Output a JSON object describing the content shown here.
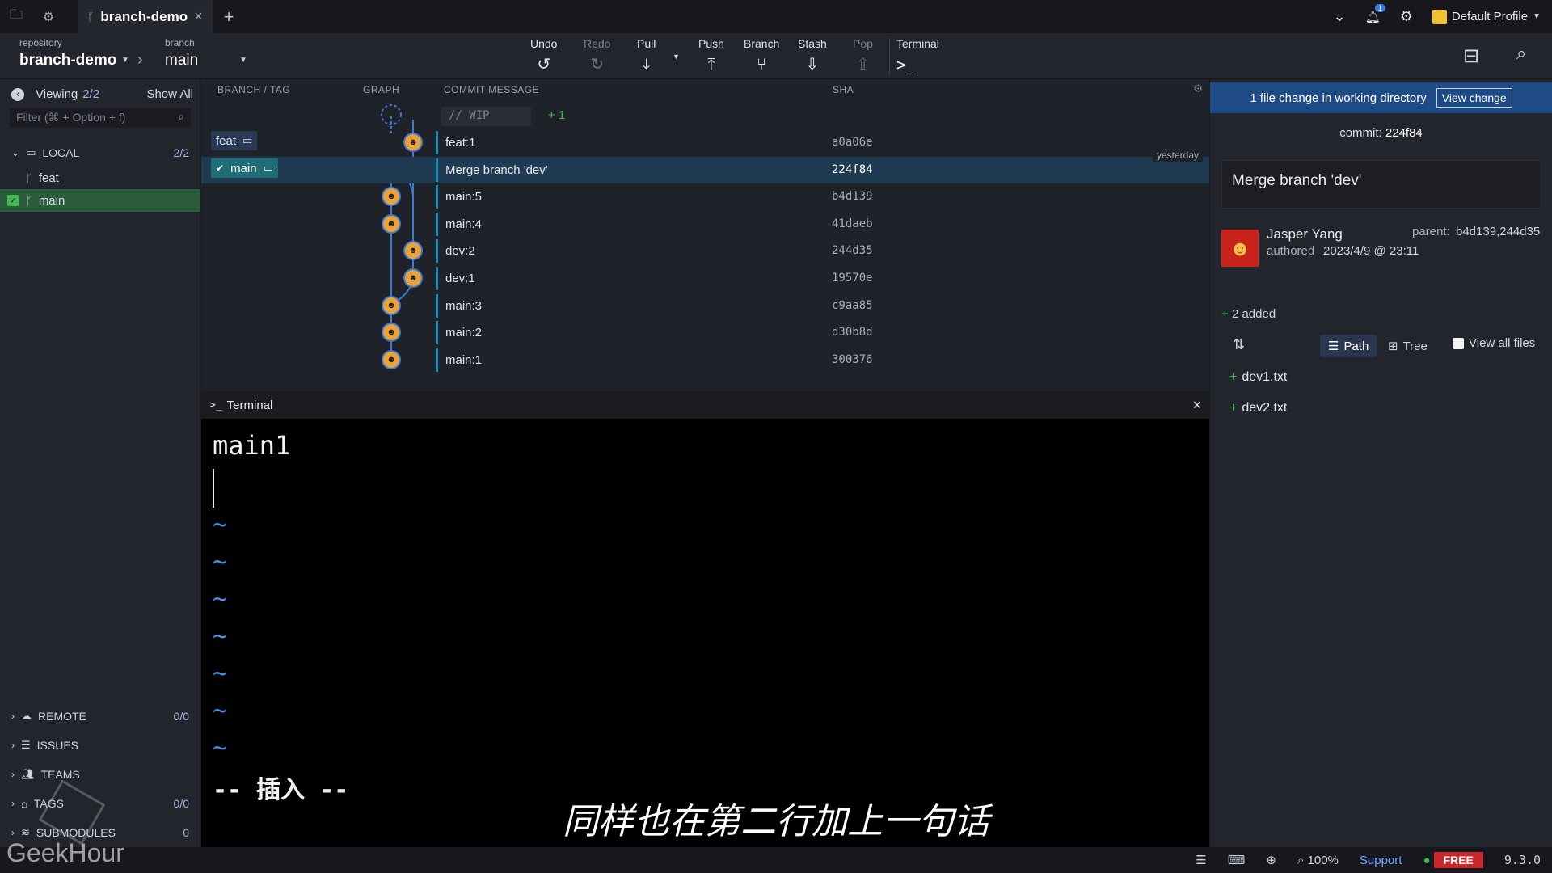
{
  "titlebar": {
    "tab_title": "branch-demo",
    "tab_close": "×",
    "new_tab": "+",
    "notifications_count": "1",
    "profile_label": "Default Profile"
  },
  "toolbar": {
    "repository_label": "repository",
    "repository_value": "branch-demo",
    "branch_label": "branch",
    "branch_value": "main",
    "undo": "Undo",
    "redo": "Redo",
    "pull": "Pull",
    "push": "Push",
    "branch": "Branch",
    "stash": "Stash",
    "pop": "Pop",
    "terminal": "Terminal"
  },
  "left_panel": {
    "viewing_label": "Viewing",
    "viewing_count": "2/2",
    "show_all": "Show All",
    "filter_placeholder": "Filter (⌘ + Option + f)",
    "local": {
      "label": "LOCAL",
      "count": "2/2",
      "branches": [
        "feat",
        "main"
      ]
    },
    "remote": {
      "label": "REMOTE",
      "count": "0/0"
    },
    "issues": {
      "label": "ISSUES"
    },
    "teams": {
      "label": "TEAMS"
    },
    "tags": {
      "label": "TAGS",
      "count": "0/0"
    },
    "submodules": {
      "label": "SUBMODULES",
      "count": "0"
    }
  },
  "graph": {
    "headers": {
      "branch_tag": "BRANCH / TAG",
      "graph": "GRAPH",
      "commit_message": "COMMIT MESSAGE",
      "sha": "SHA"
    },
    "wip_placeholder": "// WIP",
    "wip_count": "+ 1",
    "yesterday_label": "yesterday",
    "tags": {
      "feat": "feat",
      "main": "main"
    },
    "commits": [
      {
        "message": "feat:1",
        "sha": "a0a06e"
      },
      {
        "message": "Merge branch 'dev'",
        "sha": "224f84"
      },
      {
        "message": "main:5",
        "sha": "b4d139"
      },
      {
        "message": "main:4",
        "sha": "41daeb"
      },
      {
        "message": "dev:2",
        "sha": "244d35"
      },
      {
        "message": "dev:1",
        "sha": "19570e"
      },
      {
        "message": "main:3",
        "sha": "c9aa85"
      },
      {
        "message": "main:2",
        "sha": "d30b8d"
      },
      {
        "message": "main:1",
        "sha": "300376"
      }
    ]
  },
  "terminal": {
    "title": "Terminal",
    "line1": "main1",
    "tilde": "~",
    "mode": "-- 插入 --",
    "close": "×"
  },
  "caption": "同样也在第二行加上一句话",
  "right_panel": {
    "banner_text": "1 file change in working directory",
    "view_change": "View change",
    "commit_label": "commit:",
    "commit_sha": "224f84",
    "commit_message": "Merge branch 'dev'",
    "author": "Jasper Yang",
    "authored_label": "authored",
    "authored_date": "2023/4/9 @ 23:11",
    "parent_label": "parent:",
    "parent_value": "b4d139,244d35",
    "added": "2 added",
    "path_toggle": "Path",
    "tree_toggle": "Tree",
    "view_all_files": "View all files",
    "files": [
      "dev1.txt",
      "dev2.txt"
    ]
  },
  "status": {
    "zoom": "100%",
    "support": "Support",
    "plan": "FREE",
    "version": "9.3.0"
  },
  "watermark": "GeekHour",
  "colors": {
    "accent_blue": "#1e4a86",
    "selected_branch_green": "#2c5d3b",
    "graph_line": "#1a8cb8",
    "free_badge": "#c8282c"
  }
}
